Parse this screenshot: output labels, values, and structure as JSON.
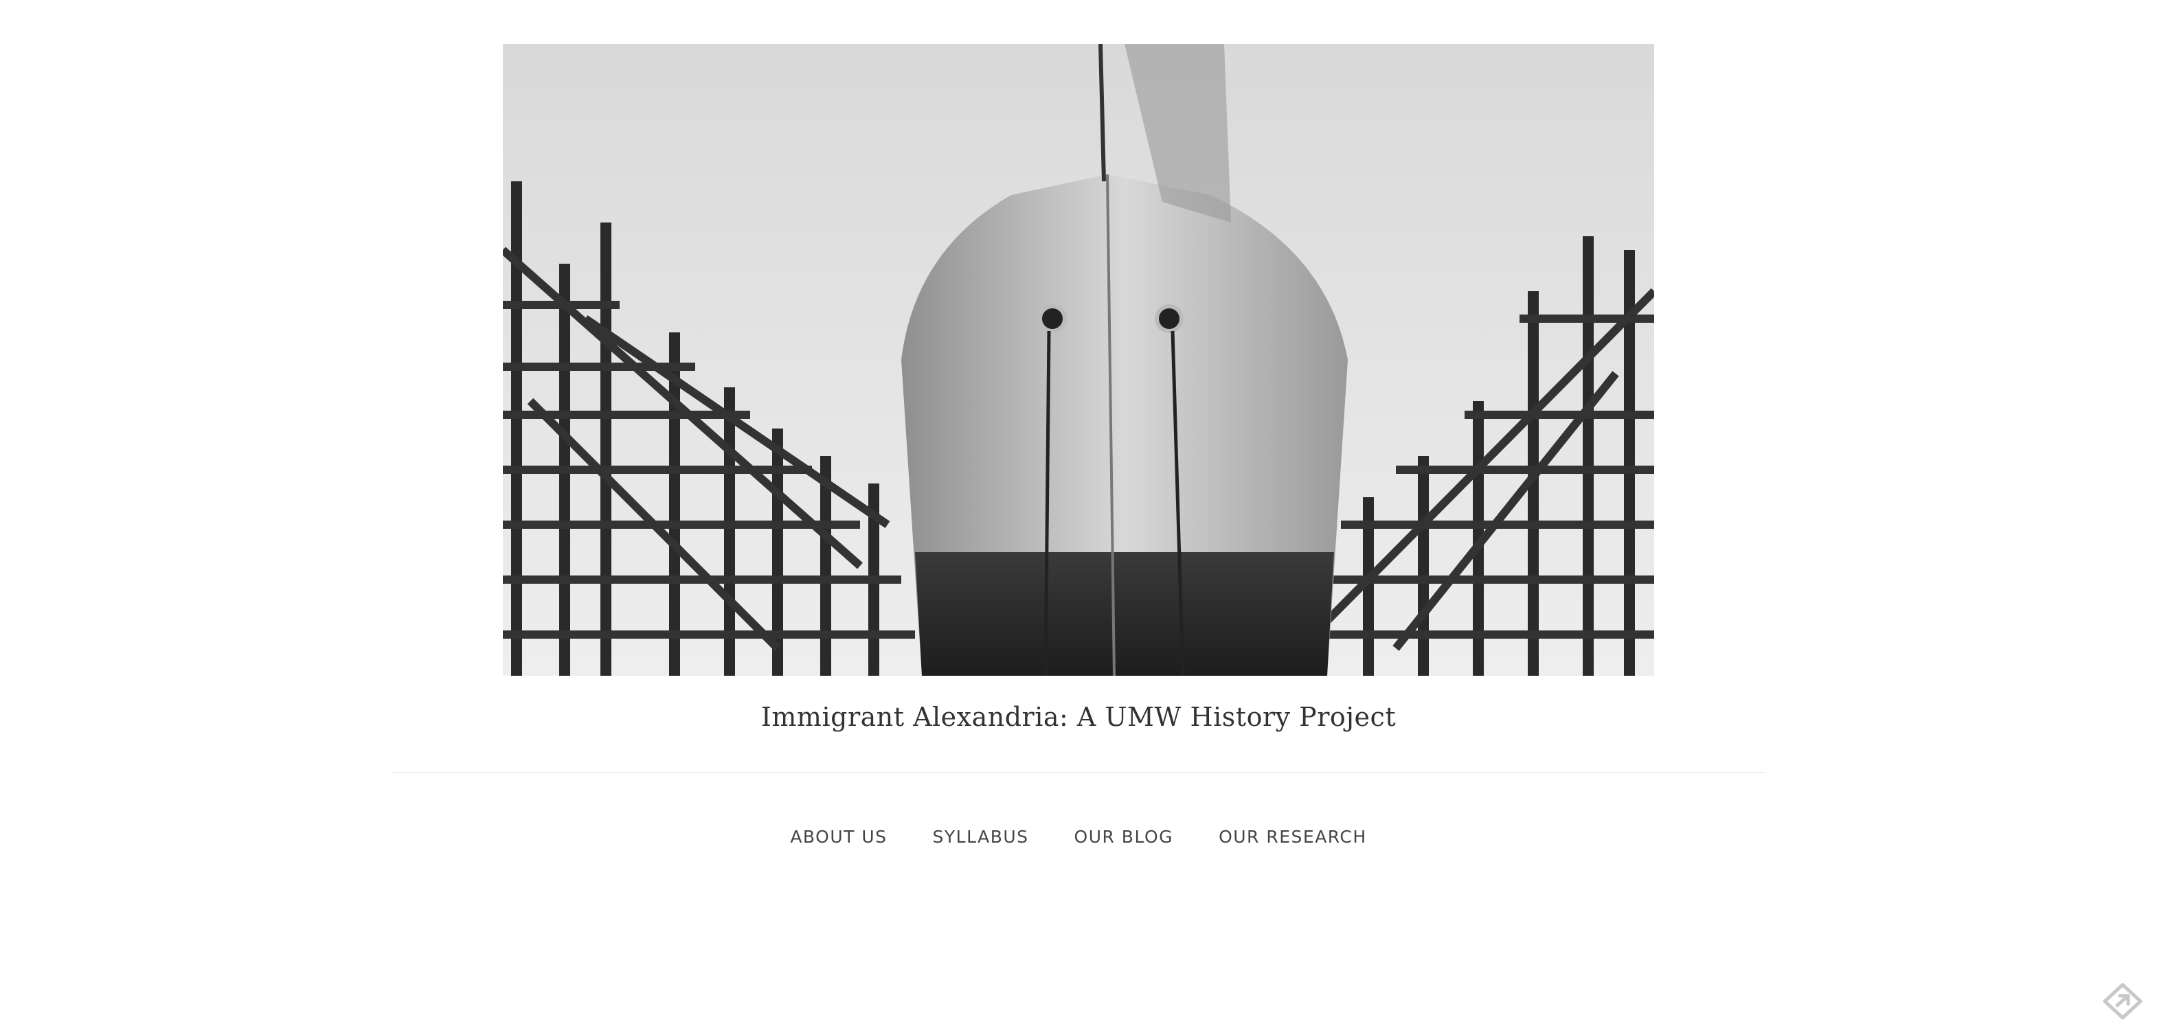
{
  "header": {
    "image_alt": "Ship hull on slipway surrounded by wooden scaffolding",
    "site_title": "Immigrant Alexandria: A UMW History Project"
  },
  "nav": {
    "items": [
      {
        "label": "ABOUT US"
      },
      {
        "label": "SYLLABUS"
      },
      {
        "label": "OUR BLOG"
      },
      {
        "label": "OUR RESEARCH"
      }
    ]
  },
  "icons": {
    "corner": "diamond-arrow-icon"
  },
  "colors": {
    "background": "#ffffff",
    "title_text": "#333333",
    "nav_text": "#444444",
    "divider": "#f1f1f1"
  }
}
